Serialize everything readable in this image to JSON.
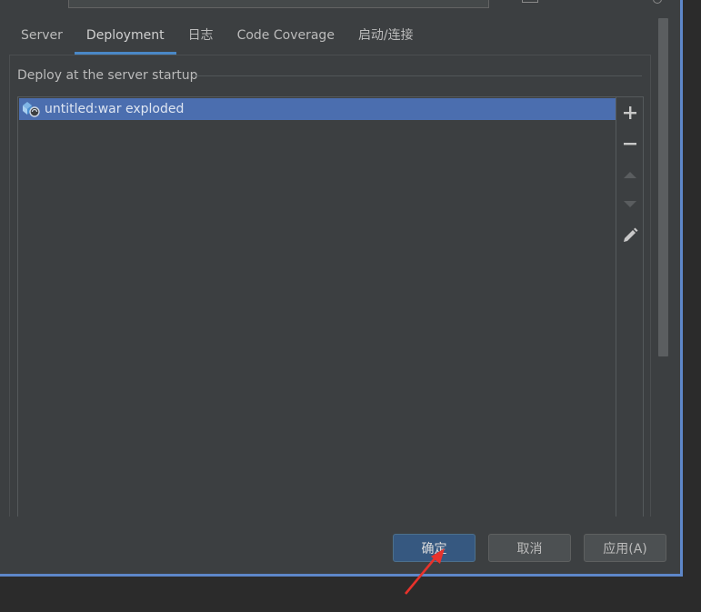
{
  "tabs": [
    {
      "label": "Server"
    },
    {
      "label": "Deployment",
      "active": true
    },
    {
      "label": "日志"
    },
    {
      "label": "Code Coverage"
    },
    {
      "label": "启动/连接"
    }
  ],
  "deployment": {
    "group_title": "Deploy at the server startup",
    "items": [
      {
        "label": "untitled:war exploded",
        "icon": "artifact-exploded-icon",
        "selected": true
      }
    ],
    "toolbar": [
      {
        "name": "add-icon",
        "enabled": true
      },
      {
        "name": "remove-icon",
        "enabled": true
      },
      {
        "name": "move-up-icon",
        "enabled": false
      },
      {
        "name": "move-down-icon",
        "enabled": false
      },
      {
        "name": "edit-icon",
        "enabled": true
      }
    ]
  },
  "buttons": {
    "ok_label": "确定",
    "cancel_label": "取消",
    "apply_label": "应用(A)"
  },
  "colors": {
    "background": "#3c3f41",
    "selection": "#4b6eaf",
    "accent": "#4a88c7",
    "primary_button": "#365880",
    "annotation_arrow": "#e8322b"
  }
}
